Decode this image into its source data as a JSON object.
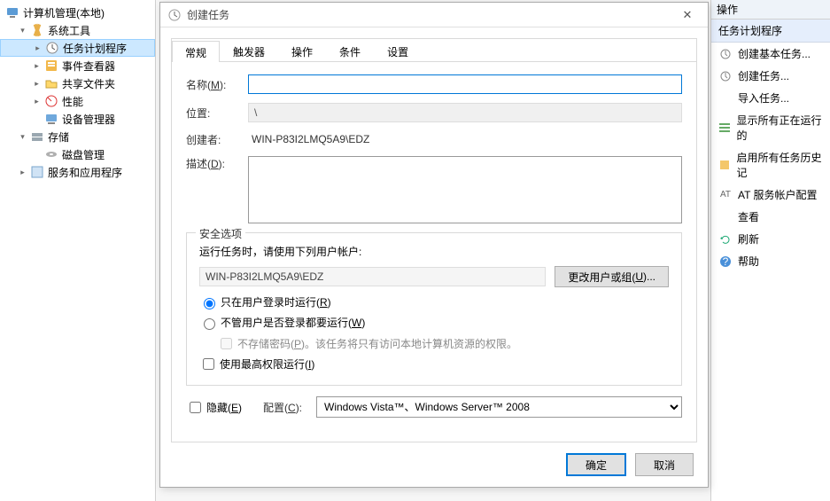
{
  "tree": {
    "root": "计算机管理(本地)",
    "system_tools": "系统工具",
    "task_scheduler": "任务计划程序",
    "event_viewer": "事件查看器",
    "shared_folders": "共享文件夹",
    "performance": "性能",
    "device_manager": "设备管理器",
    "storage": "存储",
    "disk_management": "磁盘管理",
    "services_apps": "服务和应用程序"
  },
  "right": {
    "header": "操作",
    "section": "任务计划程序",
    "items": {
      "create_basic": "创建基本任务...",
      "create_task": "创建任务...",
      "import_task": "导入任务...",
      "show_running": "显示所有正在运行的",
      "enable_history": "启用所有任务历史记",
      "at_account": "AT 服务帐户配置",
      "view": "查看",
      "refresh": "刷新",
      "help": "帮助"
    }
  },
  "dialog": {
    "title": "创建任务",
    "tabs": {
      "general": "常规",
      "triggers": "触发器",
      "actions": "操作",
      "conditions": "条件",
      "settings": "设置"
    },
    "labels": {
      "name_pre": "名称(",
      "name_u": "M",
      "name_post": "):",
      "location": "位置:",
      "creator": "创建者:",
      "desc_pre": "描述(",
      "desc_u": "D",
      "desc_post": "):",
      "security_options": "安全选项",
      "run_as_prompt": "运行任务时，请使用下列用户帐户:",
      "change_user_pre": "更改用户或组(",
      "change_user_u": "U",
      "change_user_post": ")...",
      "radio_logged_pre": "只在用户登录时运行(",
      "radio_logged_u": "R",
      "radio_logged_post": ")",
      "radio_any_pre": "不管用户是否登录都要运行(",
      "radio_any_u": "W",
      "radio_any_post": ")",
      "no_store_pre": "不存储密码(",
      "no_store_u": "P",
      "no_store_post": ")。该任务将只有访问本地计算机资源的权限。",
      "highest_pre": "使用最高权限运行(",
      "highest_u": "I",
      "highest_post": ")",
      "hidden_pre": "隐藏(",
      "hidden_u": "E",
      "hidden_post": ")",
      "configure_pre": "配置(",
      "configure_u": "C",
      "configure_post": "):",
      "ok": "确定",
      "cancel": "取消"
    },
    "values": {
      "name": "",
      "location": "\\",
      "creator": "WIN-P83I2LMQ5A9\\EDZ",
      "user_account": "WIN-P83I2LMQ5A9\\EDZ",
      "configure_for": "Windows Vista™、Windows Server™ 2008"
    }
  }
}
